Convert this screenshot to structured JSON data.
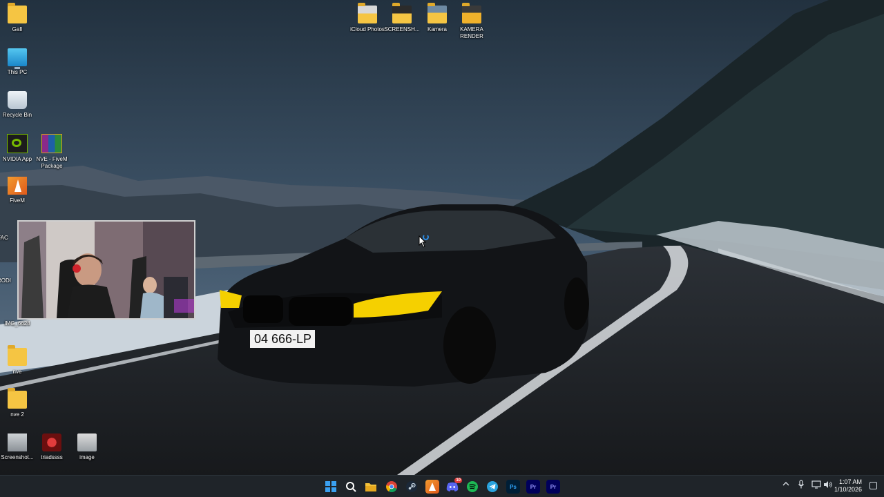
{
  "desktop": {
    "left_icons": [
      {
        "label": "Gafi"
      },
      {
        "label": "This PC"
      },
      {
        "label": "Recycle Bin"
      },
      {
        "label": "NVIDIA App"
      },
      {
        "label": "NVE - FiveM Package"
      },
      {
        "label": "FiveM"
      },
      {
        "label": "FAC"
      },
      {
        "label": "RODI"
      },
      {
        "label": "IMG_6628"
      },
      {
        "label": "nve"
      },
      {
        "label": "nve 2"
      },
      {
        "label": "Screenshot..."
      },
      {
        "label": "triadssss"
      },
      {
        "label": "image"
      }
    ],
    "top_icons": [
      {
        "label": "iCloud Photos"
      },
      {
        "label": "SCREENSH..."
      },
      {
        "label": "Kamera"
      },
      {
        "label": "KAMERA RENDER"
      }
    ],
    "wallpaper": {
      "license_plate": "04 666-LP"
    }
  },
  "taskbar": {
    "apps": [
      {
        "name": "start-icon"
      },
      {
        "name": "search-icon"
      },
      {
        "name": "file-explorer-icon"
      },
      {
        "name": "chrome-icon"
      },
      {
        "name": "steam-icon"
      },
      {
        "name": "fivem-icon"
      },
      {
        "name": "discord-icon",
        "badge": "10"
      },
      {
        "name": "spotify-icon"
      },
      {
        "name": "telegram-icon"
      },
      {
        "name": "photoshop-icon",
        "label": "Ps"
      },
      {
        "name": "premiere-icon",
        "label": "Pr"
      },
      {
        "name": "premiere-icon-2",
        "label": "Pr"
      }
    ],
    "clock": {
      "time": "1:07 AM",
      "date": "1/10/2026"
    }
  }
}
